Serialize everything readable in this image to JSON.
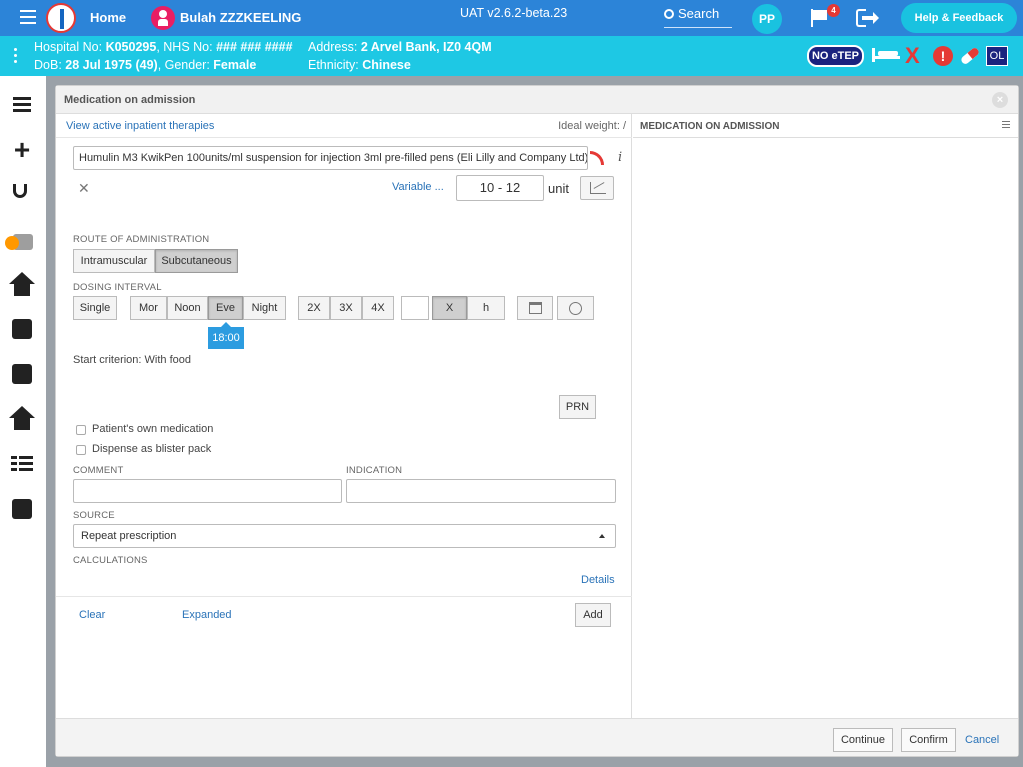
{
  "topbar": {
    "home_label": "Home",
    "patient_name": "Bulah ZZZKEELING",
    "environment": "UAT v2.6.2-beta.23",
    "search_label": "Search",
    "user_initials": "PP",
    "notification_count": "4",
    "help_label": "Help & Feedback"
  },
  "banner": {
    "hospital_no_label": "Hospital No: ",
    "hospital_no": "K050295",
    "nhs_label": ", NHS No: ",
    "nhs_no": "### ### ####",
    "dob_label": "DoB: ",
    "dob": "28 Jul 1975 (49)",
    "gender_label": ", Gender: ",
    "gender": "Female",
    "address_label": "Address: ",
    "address": "2 Arvel Bank, IZ0 4QM",
    "ethnicity_label": "Ethnicity: ",
    "ethnicity": "Chinese",
    "no_etep": "NO eTEP",
    "alert_x": "X",
    "alert_mark": "!",
    "ol_badge": "OL"
  },
  "modal": {
    "title": "Medication on admission",
    "view_active_link": "View active inpatient therapies",
    "ideal_weight": "Ideal weight: /",
    "right_title": "MEDICATION ON ADMISSION",
    "drug_value": "Humulin M3 KwikPen 100units/ml suspension for injection 3ml pre-filled pens (Eli Lilly and Company Ltd)",
    "variable_link": "Variable ...",
    "dose_value": "10 - 12",
    "dose_unit": "unit",
    "route_label": "ROUTE OF ADMINISTRATION",
    "route_options": [
      "Intramuscular",
      "Subcutaneous"
    ],
    "route_selected": "Subcutaneous",
    "dosing_label": "DOSING INTERVAL",
    "single_label": "Single",
    "times": [
      "Mor",
      "Noon",
      "Eve",
      "Night"
    ],
    "time_selected": "Eve",
    "frequencies": [
      "2X",
      "3X",
      "4X"
    ],
    "interval_value": "",
    "x_label": "X",
    "h_label": "h",
    "tooltip_time": "18:00",
    "start_criterion": "Start criterion: With food",
    "prn_label": "PRN",
    "patients_own_label": "Patient's own medication",
    "blister_label": "Dispense as blister pack",
    "comment_label": "COMMENT",
    "comment_value": "",
    "indication_label": "INDICATION",
    "indication_value": "",
    "source_label": "SOURCE",
    "source_value": "Repeat prescription",
    "calculations_label": "CALCULATIONS",
    "details_link": "Details",
    "clear_link": "Clear",
    "expanded_link": "Expanded",
    "add_label": "Add",
    "continue_label": "Continue",
    "confirm_label": "Confirm",
    "cancel_label": "Cancel"
  },
  "colors": {
    "topbar": "#2c84d8",
    "banner": "#1ec8e4",
    "accent_link": "#2a73b8",
    "tooltip": "#2c9ce0",
    "alert_red": "#e53935"
  }
}
